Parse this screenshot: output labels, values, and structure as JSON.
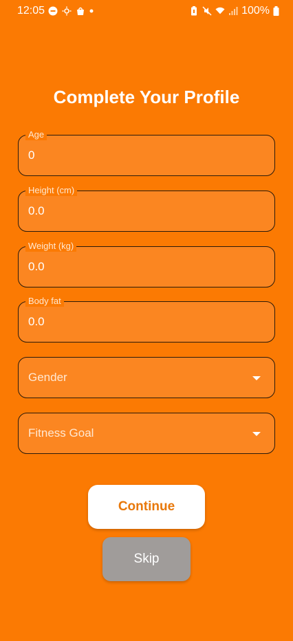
{
  "status_bar": {
    "time": "12:05",
    "battery": "100%"
  },
  "title": "Complete Your Profile",
  "fields": [
    {
      "label": "Age",
      "value": "0"
    },
    {
      "label": "Height (cm)",
      "value": "0.0"
    },
    {
      "label": "Weight (kg)",
      "value": "0.0"
    },
    {
      "label": "Body fat",
      "value": "0.0"
    }
  ],
  "selects": [
    {
      "placeholder": "Gender"
    },
    {
      "placeholder": "Fitness Goal"
    }
  ],
  "buttons": {
    "continue": "Continue",
    "skip": "Skip"
  }
}
